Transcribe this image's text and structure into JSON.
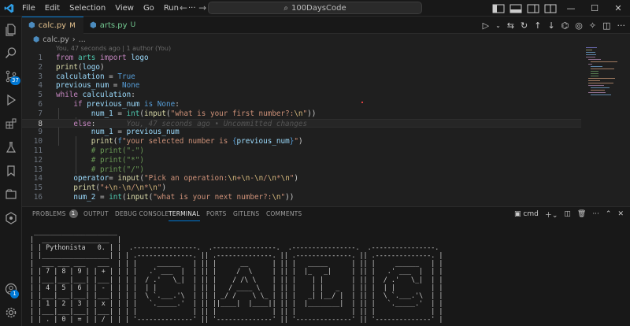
{
  "titlebar": {
    "menu": [
      "File",
      "Edit",
      "Selection",
      "View",
      "Go",
      "Run",
      "···"
    ],
    "search_text": "100DaysCode"
  },
  "activity": {
    "scm_badge": "37",
    "accounts_badge": "1"
  },
  "tabs": [
    {
      "label": "calc.py",
      "flag": "M"
    },
    {
      "label": "arts.py",
      "flag": "U"
    }
  ],
  "breadcrumb": {
    "file": "calc.py",
    "more": "..."
  },
  "blame_header": "You, 47 seconds ago | 1 author (You)",
  "inline_blame": "You, 47 seconds ago • Uncommitted changes",
  "editor": {
    "lines": [
      "1",
      "2",
      "3",
      "4",
      "5",
      "6",
      "7",
      "8",
      "9",
      "10",
      "11",
      "12",
      "13",
      "14",
      "15",
      "16"
    ],
    "code": [
      "from arts import logo",
      "print(logo)",
      "calculation = True",
      "previous_num = None",
      "while calculation:",
      "    if previous_num is None:",
      "        num_1 = int(input(\"what is your first number?:\\n\"))",
      "    else:",
      "        num_1 = previous_num",
      "        print(f\"your selected number is {previous_num}\")",
      "        # print(\"-\")",
      "        # print(\"*\")",
      "        # print(\"/\")",
      "    operator= input(\"Pick an operation:\\n+\\n-\\n/\\n*\\n\")",
      "    print(\"+\\n-\\n/\\n*\\n\")",
      "    num_2 = int(input(\"what is your next number?:\\n\"))"
    ]
  },
  "panel": {
    "tabs": [
      "PROBLEMS",
      "OUTPUT",
      "DEBUG CONSOLE",
      "TERMINAL",
      "PORTS",
      "GITLENS",
      "COMMENTS"
    ],
    "problems_count": "1",
    "shell": "cmd",
    "terminal_lines": [
      " _____________________",
      "|  _________________  |",
      "| | Pythonista   0. | |  .----------------.  .----------------.  .----------------.  .----------------.",
      "| |_________________| | | .--------------. || .--------------. || .--------------. || .--------------. |",
      "|  ___ ___ ___   ___  | | |     ______   | || |      __      | || |   _____      | || |     ______   | |",
      "| | 7 | 8 | 9 | | + | | | |   .' ___  |  | || |     /  \\     | || |  |_   _|     | || |   .' ___  |  | |",
      "| |___|___|___| |___| | | |  / .'   \\_|  | || |    / /\\ \\    | || |    | |       | || |  / .'   \\_|  | |",
      "| | 4 | 5 | 6 | | - | | | |  | |         | || |   / ____ \\   | || |    | |   _   | || |  | |         | |",
      "| |___|___|___| |___| | | |  \\ `.___.'\\  | || | _/ /    \\ \\_ | || |   _| |__/ |  | || |  \\ `.___.'\\  | |",
      "| | 1 | 2 | 3 | | x | | | |   `._____.'  | || ||____|  |____|| || |  |________|  | || |   `._____.'  | |",
      "| |___|___|___| |___| | | |              | || |              | || |              | || |              | |",
      "| | . | 0 | = | | / | | | '--------------' || '--------------' || '--------------' || '--------------' |"
    ]
  }
}
